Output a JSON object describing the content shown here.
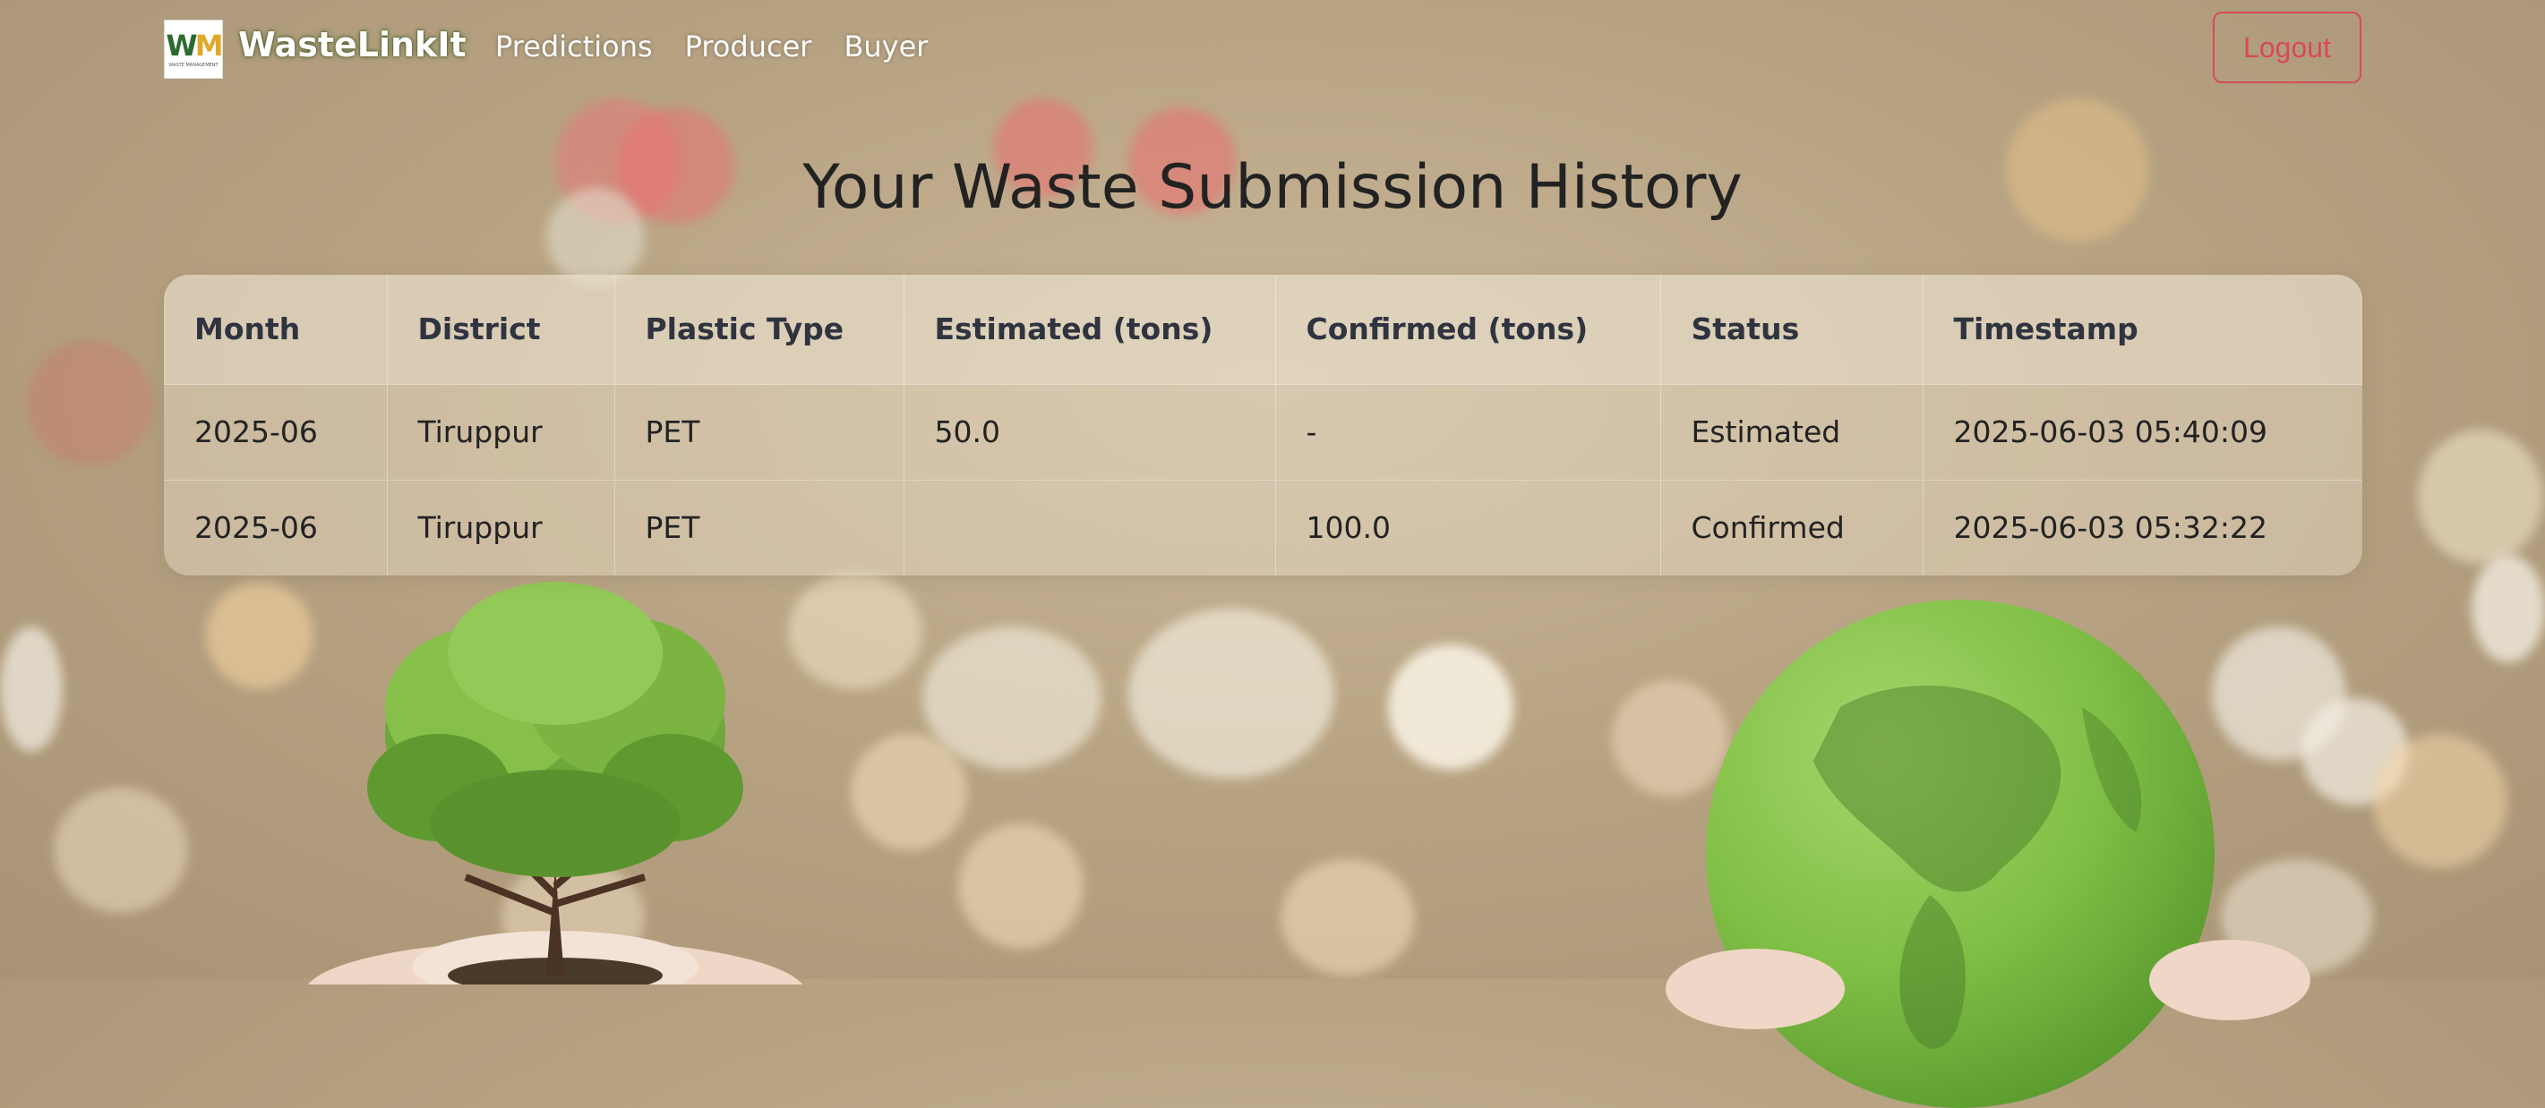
{
  "brand": {
    "name": "WasteLinkIt",
    "logo_text": "WM",
    "logo_subtext": "WASTE MANAGEMENT"
  },
  "nav": {
    "links": [
      "Predictions",
      "Producer",
      "Buyer"
    ],
    "logout_label": "Logout"
  },
  "page": {
    "title": "Your Waste Submission History"
  },
  "table": {
    "headers": [
      "Month",
      "District",
      "Plastic Type",
      "Estimated (tons)",
      "Confirmed (tons)",
      "Status",
      "Timestamp"
    ],
    "rows": [
      [
        "2025-06",
        "Tiruppur",
        "PET",
        "50.0",
        "-",
        "Estimated",
        "2025-06-03 05:40:09"
      ],
      [
        "2025-06",
        "Tiruppur",
        "PET",
        "",
        "100.0",
        "Confirmed",
        "2025-06-03 05:32:22"
      ]
    ]
  },
  "colors": {
    "logout": "#d84a55",
    "brand_glow": "#2d4a1c"
  }
}
